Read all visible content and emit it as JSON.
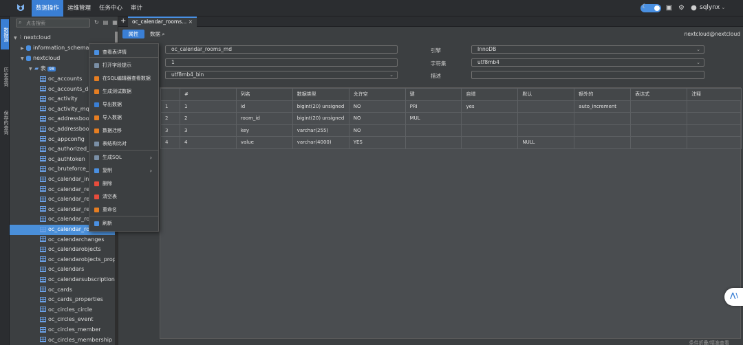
{
  "nav": {
    "items": [
      "数据操作",
      "运维管理",
      "任务中心",
      "审计"
    ],
    "active": 0
  },
  "topright": {
    "user": "sqlynx"
  },
  "rail": {
    "items": [
      "数据源",
      "历史查询",
      "保存的查询"
    ]
  },
  "tree": {
    "search_placeholder": "点击搜索",
    "root": "nextcloud",
    "schema": "information_schema",
    "db": "nextcloud",
    "folder": "表",
    "folder_count": "98",
    "tables": [
      "oc_accounts",
      "oc_accounts_dat",
      "oc_activity",
      "oc_activity_mq",
      "oc_addressbook",
      "oc_addressbook",
      "oc_appconfig",
      "oc_authorized_g",
      "oc_authtoken",
      "oc_bruteforce_at",
      "oc_calendar_invit",
      "oc_calendar_rem",
      "oc_calendar_resc",
      "oc_calendar_resc",
      "oc_calendar_roor",
      "oc_calendar_roo",
      "oc_calendarchanges",
      "oc_calendarobjects",
      "oc_calendarobjects_props",
      "oc_calendars",
      "oc_calendarsubscriptions",
      "oc_cards",
      "oc_cards_properties",
      "oc_circles_circle",
      "oc_circles_event",
      "oc_circles_member",
      "oc_circles_membership"
    ],
    "selected_index": 15
  },
  "menu": {
    "items": [
      "查看表详情",
      "打开字段提示",
      "在SQL编辑器查看数据",
      "生成测试数据",
      "导出数据",
      "导入数据",
      "数据迁移",
      "表结构比对",
      "生成SQL",
      "复制",
      "删除",
      "清空表",
      "重命名",
      "刷新"
    ]
  },
  "tab": {
    "label": "oc_calendar_rooms..."
  },
  "subbar": {
    "attr_label": "属性",
    "data_label": "数据",
    "connection": "nextcloud@nextcloud"
  },
  "props": {
    "table_name": "oc_calendar_rooms_md",
    "auto_inc": "1",
    "collation": "utf8mb4_bin",
    "engine_label": "引擎",
    "engine": "InnoDB",
    "charset_label": "字符集",
    "charset": "utf8mb4",
    "desc_label": "描述",
    "desc": ""
  },
  "grid": {
    "headers": [
      "",
      "#",
      "列名",
      "数据类型",
      "允许空",
      "键",
      "自增",
      "默认",
      "额外的",
      "表达式",
      "注释"
    ],
    "rows": [
      [
        "1",
        "1",
        "id",
        "bigint(20) unsigned",
        "NO",
        "PRI",
        "yes",
        "",
        "auto_increment",
        "",
        ""
      ],
      [
        "2",
        "2",
        "room_id",
        "bigint(20) unsigned",
        "NO",
        "MUL",
        "",
        "",
        "",
        "",
        ""
      ],
      [
        "3",
        "3",
        "key",
        "varchar(255)",
        "NO",
        "",
        "",
        "",
        "",
        "",
        ""
      ],
      [
        "4",
        "4",
        "value",
        "varchar(4000)",
        "YES",
        "",
        "",
        "NULL",
        "",
        "",
        ""
      ]
    ]
  },
  "footer": {
    "text": "条件折叠/精准查看"
  },
  "colors": {
    "accent": "#3a7fd5",
    "bg": "#3c3f41",
    "bar": "#2b2d30"
  }
}
